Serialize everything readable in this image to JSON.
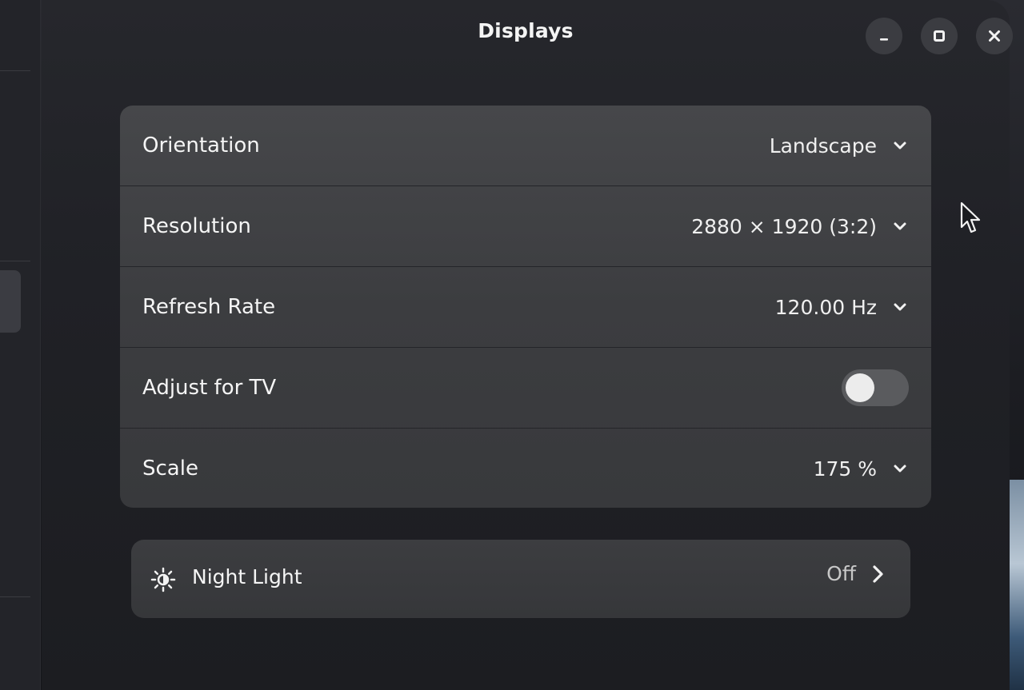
{
  "window": {
    "title": "Displays"
  },
  "window_controls": [
    {
      "name": "minimize-button",
      "icon": "minimize-icon"
    },
    {
      "name": "maximize-button",
      "icon": "maximize-icon"
    },
    {
      "name": "close-button",
      "icon": "close-icon"
    }
  ],
  "settings": {
    "orientation": {
      "label": "Orientation",
      "value": "Landscape",
      "icon": "chevron-down-icon"
    },
    "resolution": {
      "label": "Resolution",
      "value": "2880 × 1920 (3:2)",
      "icon": "chevron-down-icon"
    },
    "refresh_rate": {
      "label": "Refresh Rate",
      "value": "120.00 Hz",
      "icon": "chevron-down-icon"
    },
    "adjust_for_tv": {
      "label": "Adjust for TV",
      "enabled": false
    },
    "scale": {
      "label": "Scale",
      "value": "175 %",
      "icon": "chevron-down-icon"
    }
  },
  "night_light": {
    "label": "Night Light",
    "value": "Off",
    "icon": "night-light-icon",
    "arrow_icon": "chevron-right-icon"
  },
  "colors": {
    "window_bg": "#202126",
    "card_bg": "#3c3d40",
    "toggle_off": "#5a5b5e",
    "text": "#f5f5f5"
  }
}
